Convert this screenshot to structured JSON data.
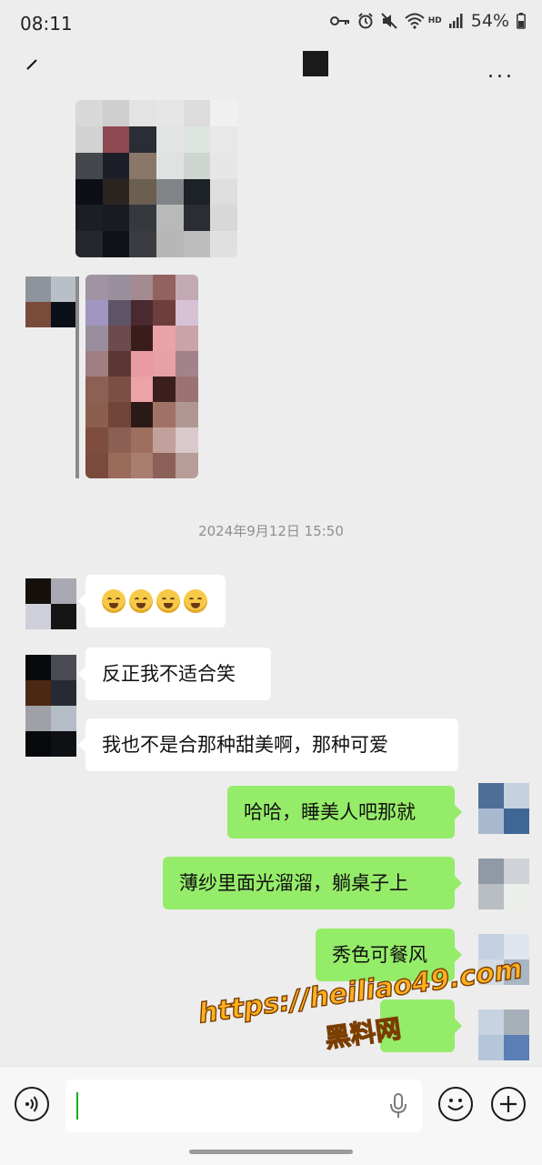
{
  "status_bar": {
    "time": "08:11",
    "network": "HD",
    "battery": "54%",
    "icons": [
      "key-icon",
      "alarm-icon",
      "mute-icon",
      "wifi-icon",
      "signal-icon",
      "battery-icon"
    ]
  },
  "title_bar": {
    "back_icon": "back-icon",
    "more_label": "..."
  },
  "timestamp": "2024年9月12日 15:50",
  "messages": [
    {
      "side": "in",
      "kind": "emoji",
      "emojis": [
        "rofl-emoji",
        "rofl-emoji",
        "holding-back-tears-emoji",
        "holding-back-tears-emoji"
      ]
    },
    {
      "side": "in",
      "text": "反正我不适合笑"
    },
    {
      "side": "in",
      "text": "我也不是合那种甜美啊，那种可爱"
    },
    {
      "side": "out",
      "text": "哈哈，睡美人吧那就"
    },
    {
      "side": "out",
      "text": "薄纱里面光溜溜，躺桌子上"
    },
    {
      "side": "out",
      "text": "秀色可餐风"
    }
  ],
  "watermark": {
    "url": "https://heiliao49.com",
    "name": "黑料网"
  },
  "input_bar": {
    "value": "",
    "icons": [
      "voice-icon",
      "microphone-icon",
      "emoji-icon",
      "plus-icon"
    ]
  },
  "colors": {
    "background": "#ededed",
    "outgoing_bubble": "#95ec69",
    "incoming_bubble": "#ffffff",
    "watermark": "#ffb020"
  }
}
